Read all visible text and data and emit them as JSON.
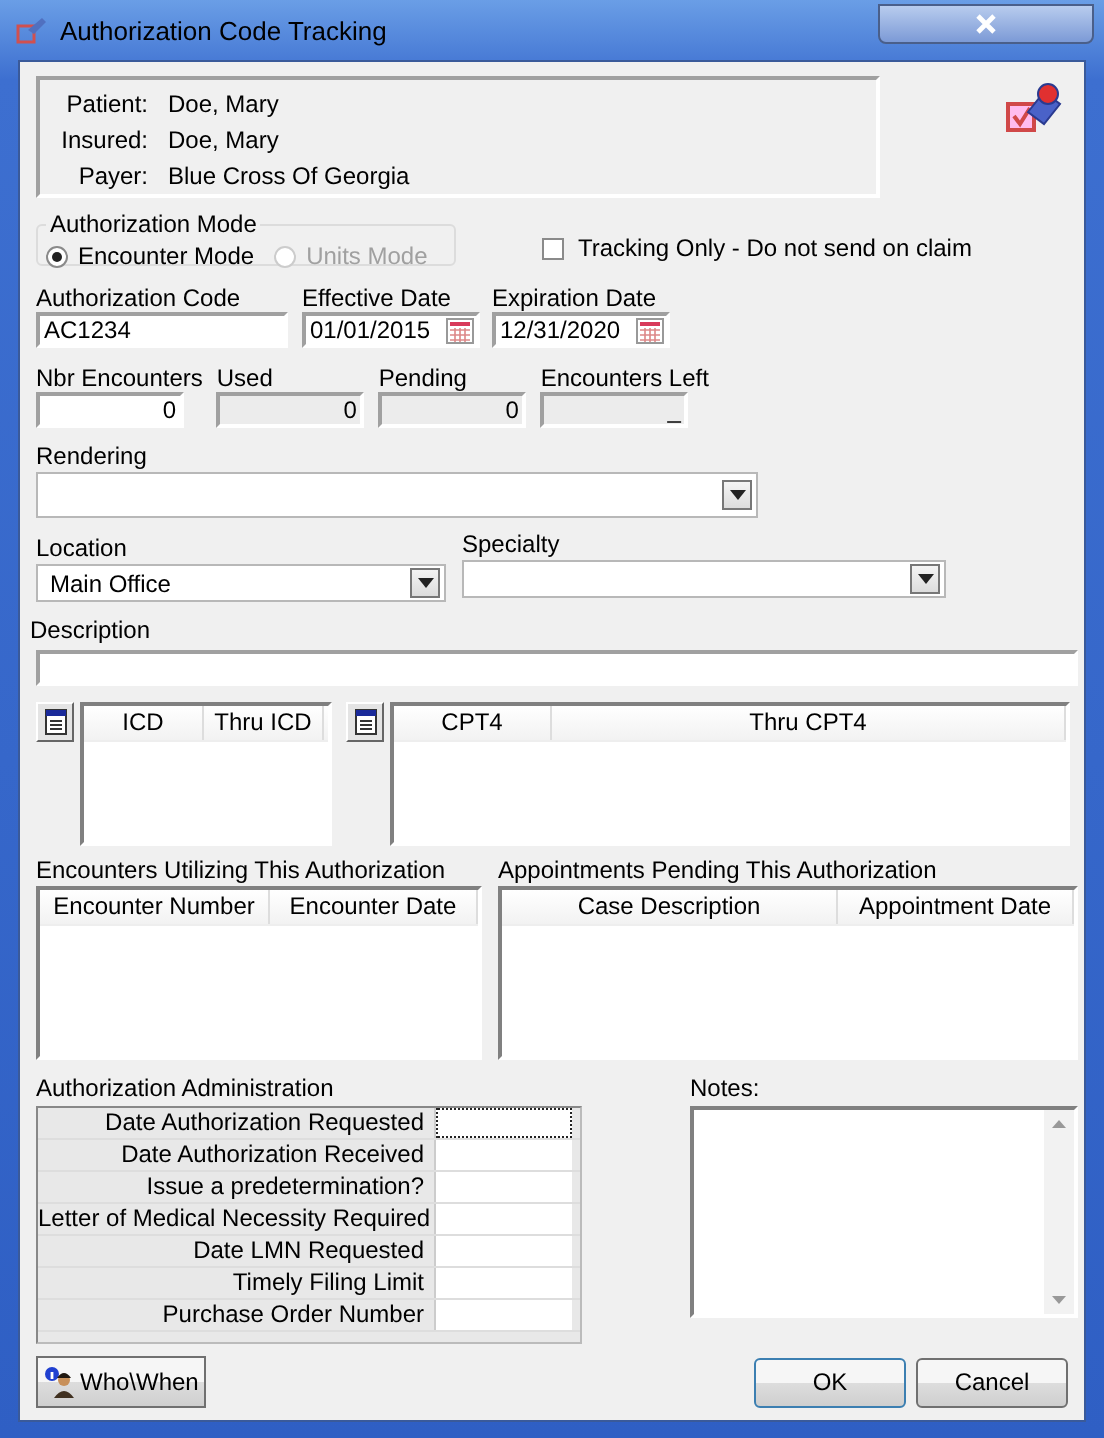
{
  "window": {
    "title": "Authorization Code Tracking"
  },
  "info": [
    {
      "label": "Patient:",
      "value": "Doe, Mary"
    },
    {
      "label": "Insured:",
      "value": "Doe, Mary"
    },
    {
      "label": "Payer:",
      "value": "Blue Cross Of Georgia"
    }
  ],
  "authorization_mode": {
    "label": "Authorization Mode",
    "options": [
      {
        "label": "Encounter Mode",
        "selected": true,
        "disabled": false
      },
      {
        "label": "Units Mode",
        "selected": false,
        "disabled": true
      }
    ]
  },
  "tracking_only": {
    "label": "Tracking Only - Do not send on claim",
    "checked": false
  },
  "authorization_code": {
    "label": "Authorization Code",
    "value": "AC1234"
  },
  "effective_date": {
    "label": "Effective Date",
    "value": "01/01/2015"
  },
  "expiration_date": {
    "label": "Expiration Date",
    "value": "12/31/2020"
  },
  "counts": [
    {
      "label": "Nbr Encounters",
      "value": "0",
      "disabled": false
    },
    {
      "label": "Used",
      "value": "0",
      "disabled": true
    },
    {
      "label": "Pending",
      "value": "0",
      "disabled": true
    },
    {
      "label": "Encounters Left",
      "value": "_",
      "disabled": true
    }
  ],
  "rendering": {
    "label": "Rendering"
  },
  "location": {
    "label": "Location",
    "value": "Main Office"
  },
  "specialty": {
    "label": "Specialty"
  },
  "description": {
    "label": "Description"
  },
  "icd_table": {
    "columns": [
      "ICD",
      "Thru ICD"
    ]
  },
  "cpt_table": {
    "columns": [
      "CPT4",
      "Thru CPT4"
    ]
  },
  "encounters": {
    "title": "Encounters Utilizing This Authorization",
    "columns": [
      "Encounter Number",
      "Encounter Date"
    ]
  },
  "appointments": {
    "title": "Appointments Pending This Authorization",
    "columns": [
      "Case Description",
      "Appointment Date"
    ]
  },
  "administration": {
    "title": "Authorization Administration",
    "rows": [
      {
        "label": "Date Authorization Requested",
        "selected": true
      },
      {
        "label": "Date Authorization Received",
        "selected": false
      },
      {
        "label": "Issue a predetermination?",
        "selected": false
      },
      {
        "label": "Letter of Medical Necessity Required",
        "selected": false
      },
      {
        "label": "Date LMN Requested",
        "selected": false
      },
      {
        "label": "Timely Filing Limit",
        "selected": false
      },
      {
        "label": "Purchase Order Number",
        "selected": false
      }
    ]
  },
  "notes": {
    "label": "Notes:"
  },
  "buttons": [
    {
      "label": "Who\\When",
      "kind": "info"
    },
    {
      "label": "OK",
      "kind": "default"
    },
    {
      "label": "Cancel",
      "kind": "plain"
    }
  ]
}
